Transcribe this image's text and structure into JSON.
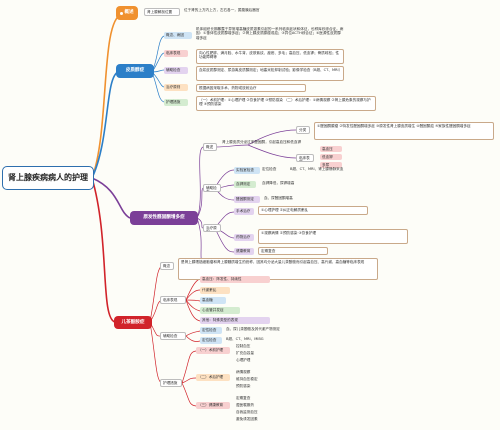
{
  "root": "肾上腺疾病病人的护理",
  "colors": {
    "orange": "#f0912f",
    "blue": "#2c7fc8",
    "purple": "#7b3f98",
    "red": "#d1232a"
  },
  "b1": {
    "label": "概述",
    "l1": "肾上腺解剖位置",
    "l1_text": "位于肾的上方内上方，左右各一，属腹膜后器官"
  },
  "b2": {
    "label": "皮质醇症",
    "overview_tag": "概念、病因",
    "overview": "机体组织长期暴露于异常增高糖皮质激素引起的一系列临床症状和体征，也称库欣综合征。病因：①垂体性皮质醇增多症；②肾上腺皮质腺瘤或癌；③异位ACTH综合征；④医源性皮质醇增多症",
    "clinical_tag": "临床表现",
    "clinical": "向心性肥胖、满月脸、水牛背、皮肤紫纹、痤疮、多毛；高血压、低血钾；骨质疏松；性功能障碍等",
    "exam_tag": "辅助检查",
    "exam": "血浆皮质醇测定、尿游离皮质醇测定；地塞米松抑制试验；影像学检查（B超、CT、MRI）",
    "treat_tag": "治疗原则",
    "treat": "根据病因采取手术、药物或放射治疗",
    "care_tag": "护理措施",
    "care": "（一）术前护理：①心理护理 ②饮食护理 ③预防感染 （二）术后护理：①病情观察 ②肾上腺危象的观察与护理 ③预防感染"
  },
  "b3": {
    "label": "原发性醛固酮增多症",
    "overview": "概述",
    "concept": "肾上腺皮质分泌过多醛固酮，引起高血压和低血钾",
    "classify": "分类",
    "classify_text": "①醛固酮腺瘤 ②特发性醛固酮增多症 ③原发性肾上腺皮质增生 ④醛固酮癌 ⑤家族性醛固酮增多症",
    "clinical": "临床表现",
    "c1": "高血压",
    "c2": "低血钾",
    "c3": "多尿",
    "exam": "辅助检查",
    "e1": "实验室检查",
    "e2": "血钾测定",
    "e2_text": "血钾降低，尿钾增高",
    "e3": "醛固酮测定",
    "e3_text": "血、尿醛固酮增高",
    "e4": "定位检查",
    "e4_text": "B超、CT、MRI、肾上腺静脉采血",
    "treat": "治疗原则",
    "t1": "手术治疗",
    "t1_text": "①心理护理 ②纠正电解质紊乱",
    "t2": "药物治疗",
    "t2_text": "①观察病情 ②预防感染 ③饮食护理",
    "t3": "健康教育",
    "t3_text": "定期复查",
    "care": "护理措施",
    "care_text": "①术前护理 ②术后护理"
  },
  "b4": {
    "label": "儿茶酚胺症",
    "concept_tag": "概念",
    "concept": "是肾上腺嗜铬细胞瘤和肾上腺髓质增生的统称，因其均分泌大量儿茶酚胺而引起高血压、高代谢、高血糖等临床表现",
    "clinical_tag": "临床表现",
    "c1": "高血压：阵发性、持续性",
    "c2": "代谢紊乱",
    "c3": "高血糖",
    "c4": "心血管并发症",
    "c5": "其他：特殊类型的表现",
    "exam_tag": "辅助检查",
    "e1": "定性检查",
    "e1_text": "血、尿儿茶酚胺及其代谢产物测定",
    "e2": "定位检查",
    "e2_text": "B超、CT、MRI、MIBG",
    "care_tag": "护理措施",
    "p1": "（一）术前护理",
    "p1a": "控制血压",
    "p1b": "扩充血容量",
    "p1c": "心理护理",
    "p2": "（二）术后护理",
    "p2a": "病情观察",
    "p2b": "维持血压稳定",
    "p2c": "预防感染",
    "p3": "（三）健康教育",
    "p3a": "定期复查",
    "p3b": "遵医嘱服药",
    "p3c": "自我监测血压",
    "p3d": "避免诱发因素"
  }
}
